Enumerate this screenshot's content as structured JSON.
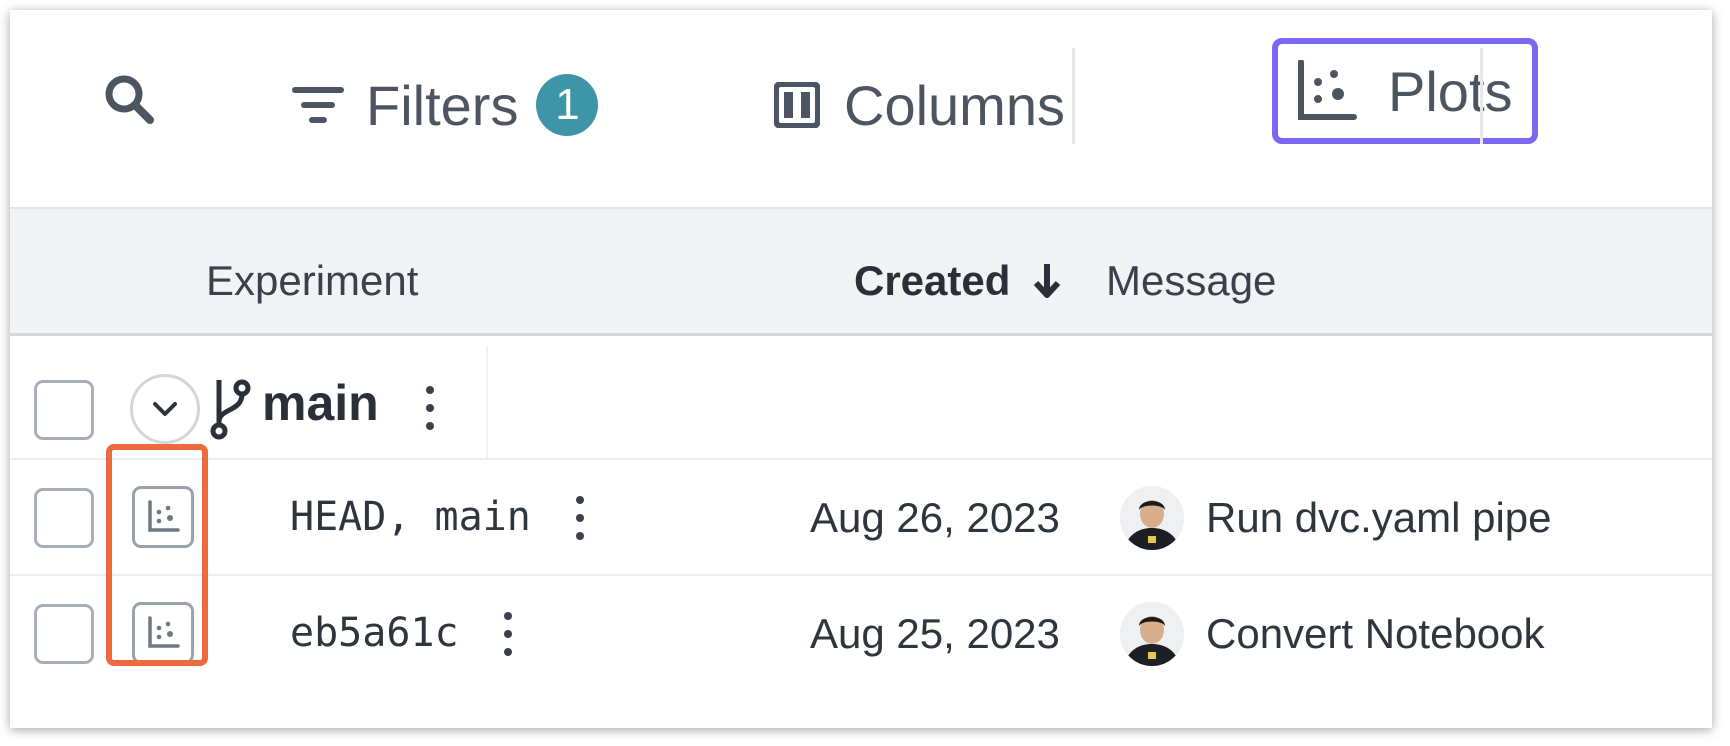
{
  "toolbar": {
    "search_icon": "search-icon",
    "filters_label": "Filters",
    "filters_count": "1",
    "columns_label": "Columns",
    "plots_label": "Plots",
    "badge_color": "#3e95a8",
    "highlight_color": "#7a68f2"
  },
  "table": {
    "columns": [
      "Experiment",
      "Created",
      "Message"
    ],
    "sorted_column": "Created",
    "sort_direction": "descending",
    "branch": {
      "name": "main"
    },
    "rows": [
      {
        "experiment": "HEAD, main",
        "created": "Aug 26, 2023",
        "message": "Run dvc.yaml pipe"
      },
      {
        "experiment": "eb5a61c",
        "created": "Aug 25, 2023",
        "message": "Convert Notebook"
      }
    ]
  },
  "annotation_color": "#ec6a3d"
}
